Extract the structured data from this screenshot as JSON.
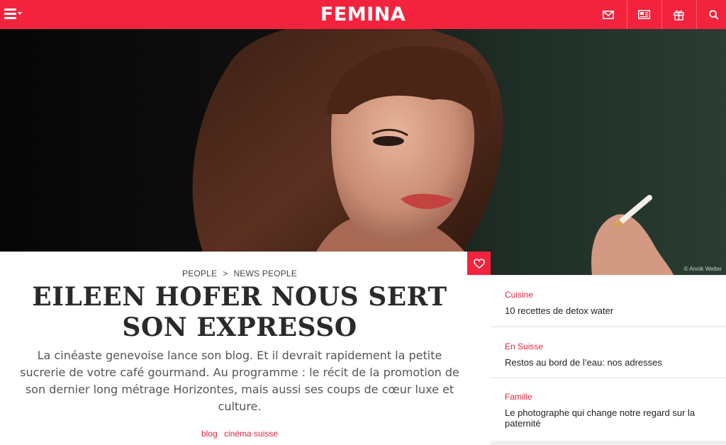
{
  "header": {
    "logo": "FEMINA",
    "brand_color": "#f3233d",
    "icons": [
      "menu-icon",
      "mail-icon",
      "magazine-icon",
      "gift-icon",
      "search-icon"
    ]
  },
  "hero": {
    "credit": "© Annik Wetter"
  },
  "article": {
    "breadcrumb": [
      "PEOPLE",
      ">",
      "NEWS PEOPLE"
    ],
    "title": "EILEEN HOFER NOUS SERT SON EXPRESSO",
    "lede": "La cinéaste genevoise lance son blog. Et il devrait rapidement la petite sucrerie de votre café gourmand. Au programme : le récit de la promotion de son dernier long métrage Horizontes, mais aussi ses coups de cœur luxe et culture.",
    "tags": [
      "blog",
      "cinéma suisse"
    ],
    "favorite_icon": "heart-icon"
  },
  "sidebar": {
    "items": [
      {
        "category": "Cuisine",
        "title": "10 recettes de detox water"
      },
      {
        "category": "En Suisse",
        "title": "Restos au bord de l’eau: nos adresses"
      },
      {
        "category": "Famille",
        "title": "Le photographe qui change notre regard sur la paternité"
      }
    ]
  }
}
